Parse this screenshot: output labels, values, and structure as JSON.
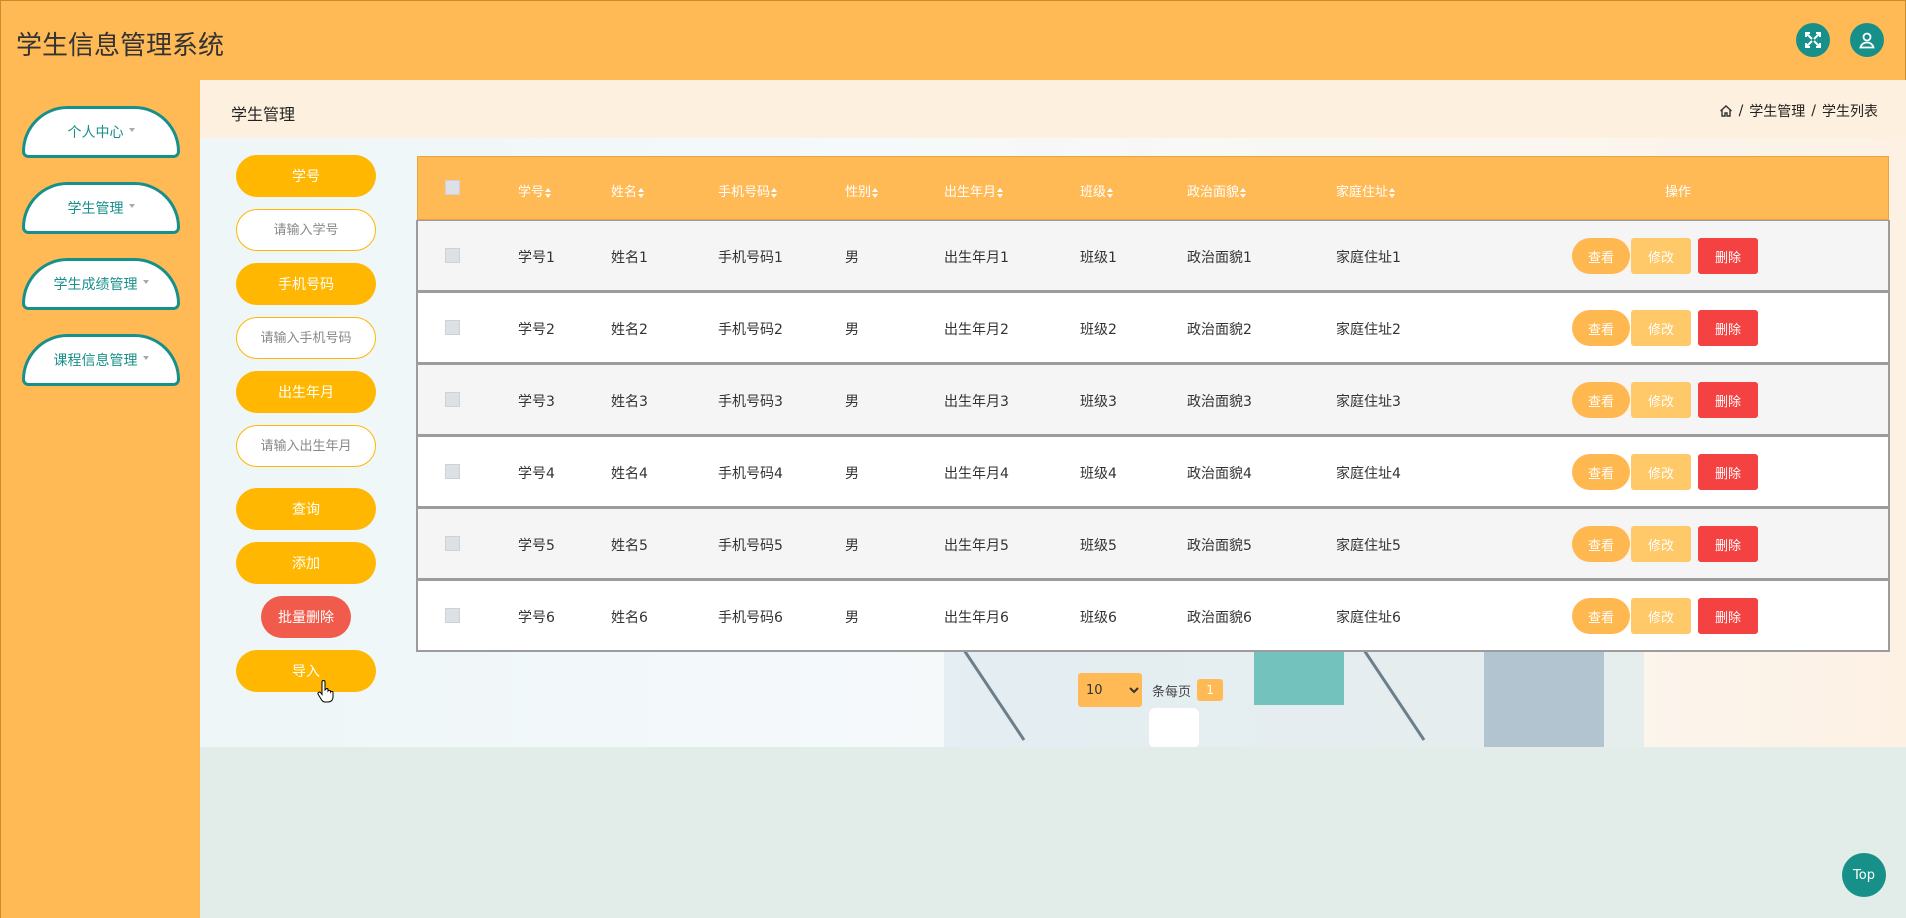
{
  "app": {
    "title": "学生信息管理系统"
  },
  "header": {
    "fullscreen_icon": "fullscreen-icon",
    "user_icon": "user-icon"
  },
  "sidebar": {
    "items": [
      {
        "label": "个人中心"
      },
      {
        "label": "学生管理"
      },
      {
        "label": "学生成绩管理"
      },
      {
        "label": "课程信息管理"
      }
    ]
  },
  "page": {
    "title": "学生管理",
    "breadcrumb": [
      "学生管理",
      "学生列表"
    ]
  },
  "search": {
    "student_id_label": "学号",
    "student_id_placeholder": "请输入学号",
    "phone_label": "手机号码",
    "phone_placeholder": "请输入手机号码",
    "birth_label": "出生年月",
    "birth_placeholder": "请输入出生年月",
    "query_button": "查询",
    "add_button": "添加",
    "batch_delete_button": "批量删除",
    "import_button": "导入"
  },
  "table": {
    "columns": [
      "学号",
      "姓名",
      "手机号码",
      "性别",
      "出生年月",
      "班级",
      "政治面貌",
      "家庭住址",
      "操作"
    ],
    "actions": {
      "view": "查看",
      "edit": "修改",
      "delete": "删除"
    },
    "rows": [
      [
        "学号1",
        "姓名1",
        "手机号码1",
        "男",
        "出生年月1",
        "班级1",
        "政治面貌1",
        "家庭住址1"
      ],
      [
        "学号2",
        "姓名2",
        "手机号码2",
        "男",
        "出生年月2",
        "班级2",
        "政治面貌2",
        "家庭住址2"
      ],
      [
        "学号3",
        "姓名3",
        "手机号码3",
        "男",
        "出生年月3",
        "班级3",
        "政治面貌3",
        "家庭住址3"
      ],
      [
        "学号4",
        "姓名4",
        "手机号码4",
        "男",
        "出生年月4",
        "班级4",
        "政治面貌4",
        "家庭住址4"
      ],
      [
        "学号5",
        "姓名5",
        "手机号码5",
        "男",
        "出生年月5",
        "班级5",
        "政治面貌5",
        "家庭住址5"
      ],
      [
        "学号6",
        "姓名6",
        "手机号码6",
        "男",
        "出生年月6",
        "班级6",
        "政治面貌6",
        "家庭住址6"
      ]
    ]
  },
  "pagination": {
    "page_size": "10",
    "per_page_label": "条每页",
    "current_page": "1"
  },
  "top_button": "Top",
  "colors": {
    "primary": "#ffba56",
    "accent": "#17908a",
    "pill": "#ffb701",
    "danger": "#f44141"
  }
}
